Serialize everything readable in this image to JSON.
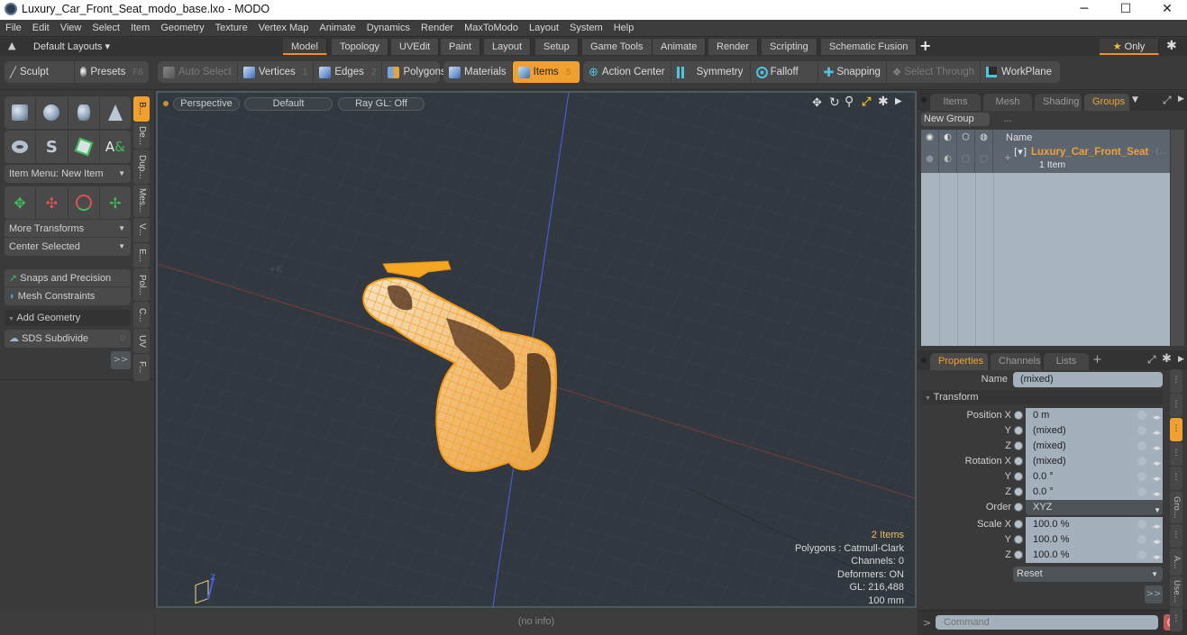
{
  "window": {
    "title": "Luxury_Car_Front_Seat_modo_base.lxo - MODO",
    "controls": {
      "minimize": "─",
      "maximize": "☐",
      "close": "✕"
    }
  },
  "menu": [
    "File",
    "Edit",
    "View",
    "Select",
    "Item",
    "Geometry",
    "Texture",
    "Vertex Map",
    "Animate",
    "Dynamics",
    "Render",
    "MaxToModo",
    "Layout",
    "System",
    "Help"
  ],
  "layouts": {
    "default_layouts": "Default Layouts ▾",
    "tabs": [
      "Model",
      "Topology",
      "UVEdit",
      "Paint",
      "Layout",
      "Setup",
      "Game Tools",
      "Animate",
      "Render",
      "Scripting",
      "Schematic Fusion"
    ],
    "active_tab": "Model",
    "add": "+",
    "only": "★ Only",
    "gear": "✱"
  },
  "toolbar": {
    "sculpt": "Sculpt",
    "presets": "Presets",
    "presets_key": "F6",
    "auto_select": "Auto Select",
    "vertices": "Vertices",
    "vertices_key": "1",
    "edges": "Edges",
    "edges_key": "2",
    "polygons": "Polygons",
    "materials": "Materials",
    "items": "Items",
    "items_key": "5",
    "action_center": "Action Center",
    "symmetry": "Symmetry",
    "falloff": "Falloff",
    "snapping": "Snapping",
    "select_through": "Select Through",
    "workplane": "WorkPlane"
  },
  "left_panel": {
    "item_menu": "Item Menu: New Item",
    "more_transforms": "More Transforms",
    "center_selected": "Center Selected",
    "snaps": "Snaps and Precision",
    "mesh_constraints": "Mesh Constraints",
    "add_geometry": "Add Geometry",
    "sds_subdivide": "SDS Subdivide",
    "sds_key": "D",
    "more": ">>",
    "vertical_tabs": [
      "B...",
      "De...",
      "Dup...",
      "Mes...",
      "V...",
      "E...",
      "Pol...",
      "C...",
      "UV",
      "F..."
    ]
  },
  "viewport": {
    "perspective": "Perspective",
    "shading": "Default",
    "raygl": "Ray GL: Off",
    "info": {
      "items": "2 Items",
      "polygons": "Polygons : Catmull-Clark",
      "channels": "Channels: 0",
      "deformers": "Deformers: ON",
      "gl": "GL: 216,488",
      "scale": "100 mm"
    },
    "axis_label": "Z"
  },
  "status": {
    "info": "(no info)"
  },
  "groups_panel": {
    "tabs": [
      "Items",
      "Mesh ...",
      "Shading",
      "Groups"
    ],
    "active_tab": "Groups",
    "new_group": "New Group",
    "column_name": "Name",
    "group_name": "Luxury_Car_Front_Seat",
    "group_suffix": "(...",
    "group_count": "1 Item"
  },
  "properties_panel": {
    "tabs": [
      "Properties",
      "Channels",
      "Lists"
    ],
    "active_tab": "Properties",
    "add": "+",
    "name_label": "Name",
    "name_value": "(mixed)",
    "section": "Transform",
    "rows": [
      {
        "label": "Position X",
        "value": "0 m"
      },
      {
        "label": "Y",
        "value": "(mixed)"
      },
      {
        "label": "Z",
        "value": "(mixed)"
      },
      {
        "label": "Rotation X",
        "value": "(mixed)"
      },
      {
        "label": "Y",
        "value": "0.0 °"
      },
      {
        "label": "Z",
        "value": "0.0 °"
      },
      {
        "label": "Order",
        "value": "XYZ"
      },
      {
        "label": "Scale X",
        "value": "100.0 %"
      },
      {
        "label": "Y",
        "value": "100.0 %"
      },
      {
        "label": "Z",
        "value": "100.0 %"
      }
    ],
    "reset": "Reset",
    "more": ">>",
    "side_tabs": [
      "⋮",
      "⋮",
      "⋮",
      "⋮",
      "⋮",
      "Gro...",
      "⋮",
      "A...",
      "Use...",
      "⋮"
    ]
  },
  "command": {
    "prompt": ">",
    "placeholder": "Command"
  },
  "colors": {
    "accent": "#f0a030",
    "viewport_bg": "#323840",
    "mesh": "#f5a623"
  }
}
